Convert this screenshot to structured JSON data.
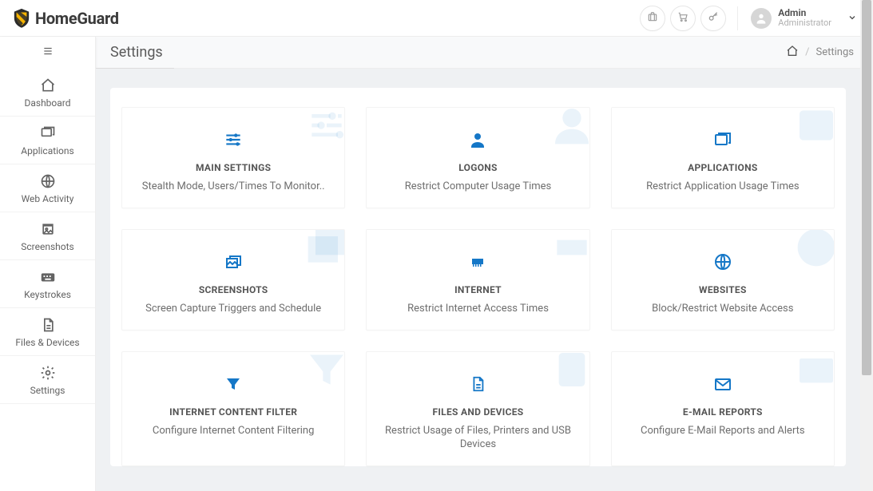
{
  "brand": {
    "name": "HomeGuard"
  },
  "user": {
    "name": "Admin",
    "role": "Administrator"
  },
  "subbar": {
    "title": "Settings",
    "crumb_current": "Settings"
  },
  "sidebar": {
    "items": [
      {
        "label": "Dashboard"
      },
      {
        "label": "Applications"
      },
      {
        "label": "Web Activity"
      },
      {
        "label": "Screenshots"
      },
      {
        "label": "Keystrokes"
      },
      {
        "label": "Files & Devices"
      },
      {
        "label": "Settings"
      }
    ]
  },
  "cards": [
    {
      "title": "MAIN SETTINGS",
      "desc": "Stealth Mode, Users/Times To Monitor.."
    },
    {
      "title": "LOGONS",
      "desc": "Restrict Computer Usage Times"
    },
    {
      "title": "APPLICATIONS",
      "desc": "Restrict Application Usage Times"
    },
    {
      "title": "SCREENSHOTS",
      "desc": "Screen Capture Triggers and Schedule"
    },
    {
      "title": "INTERNET",
      "desc": "Restrict Internet Access Times"
    },
    {
      "title": "WEBSITES",
      "desc": "Block/Restrict Website Access"
    },
    {
      "title": "INTERNET CONTENT FILTER",
      "desc": "Configure Internet Content Filtering"
    },
    {
      "title": "FILES AND DEVICES",
      "desc": "Restrict Usage of Files, Printers and USB Devices"
    },
    {
      "title": "E-MAIL REPORTS",
      "desc": "Configure E-Mail Reports and Alerts"
    }
  ]
}
